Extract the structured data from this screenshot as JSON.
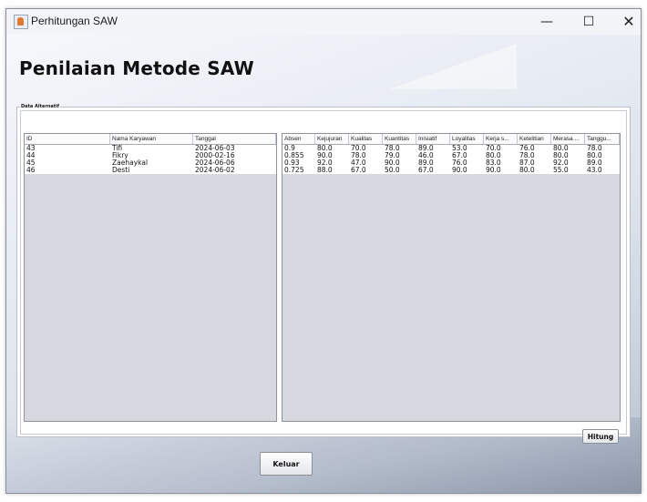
{
  "window": {
    "title": "Perhitungan SAW",
    "controls": {
      "minimize": "—",
      "maximize": "☐",
      "close": "✕"
    }
  },
  "heading": "Penilaian Metode SAW",
  "panel": {
    "title": "Data Alternatif",
    "left_table": {
      "columns": [
        "ID",
        "Nama Karyawan",
        "Tanggal"
      ],
      "rows": [
        [
          "43",
          "Tifi",
          "2024-06-03"
        ],
        [
          "44",
          "Fikry",
          "2000-02-16"
        ],
        [
          "45",
          "Zaehaykal",
          "2024-06-06"
        ],
        [
          "46",
          "Desti",
          "2024-06-02"
        ]
      ]
    },
    "right_table": {
      "columns": [
        "Absen",
        "Kejujuran",
        "Kualitas",
        "Kuantitas",
        "Inisiatif",
        "Loyalitas",
        "Kerja s...",
        "Ketelitian",
        "Merasa ...",
        "Tanggu..."
      ],
      "rows": [
        [
          "0.9",
          "80.0",
          "70.0",
          "78.0",
          "89.0",
          "53.0",
          "70.0",
          "76.0",
          "80.0",
          "78.0"
        ],
        [
          "0.855",
          "90.0",
          "78.0",
          "79.0",
          "46.0",
          "67.0",
          "80.0",
          "78.0",
          "80.0",
          "80.0"
        ],
        [
          "0.93",
          "92.0",
          "47.0",
          "90.0",
          "89.0",
          "76.0",
          "83.0",
          "87.0",
          "92.0",
          "89.0"
        ],
        [
          "0.725",
          "88.0",
          "67.0",
          "50.0",
          "67.0",
          "90.0",
          "90.0",
          "80.0",
          "55.0",
          "43.0"
        ]
      ]
    },
    "hitung_label": "Hitung"
  },
  "keluar_label": "Keluar",
  "colors": {
    "table_bg": "#d5d8df",
    "accent_app_icon": "#e07a2e"
  }
}
